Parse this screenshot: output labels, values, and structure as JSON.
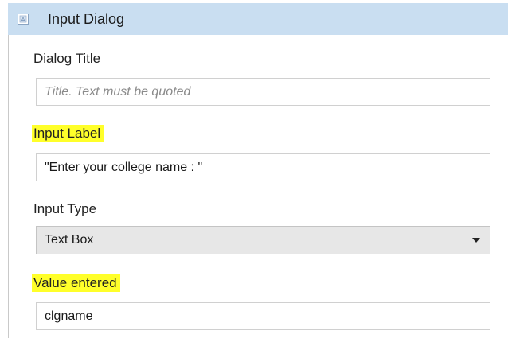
{
  "header": {
    "title": "Input Dialog",
    "icon": "activity-icon"
  },
  "fields": {
    "dialog_title": {
      "label": "Dialog Title",
      "value": "",
      "placeholder": "Title. Text must be quoted"
    },
    "input_label": {
      "label": "Input Label",
      "value": "\"Enter your college name : \""
    },
    "input_type": {
      "label": "Input Type",
      "selected": "Text Box"
    },
    "value_entered": {
      "label": "Value entered",
      "value": "clgname"
    }
  },
  "colors": {
    "header_bg": "#c9def1",
    "highlight": "#ffff2a",
    "select_bg": "#e7e7e7",
    "border": "#d0d0d0"
  }
}
